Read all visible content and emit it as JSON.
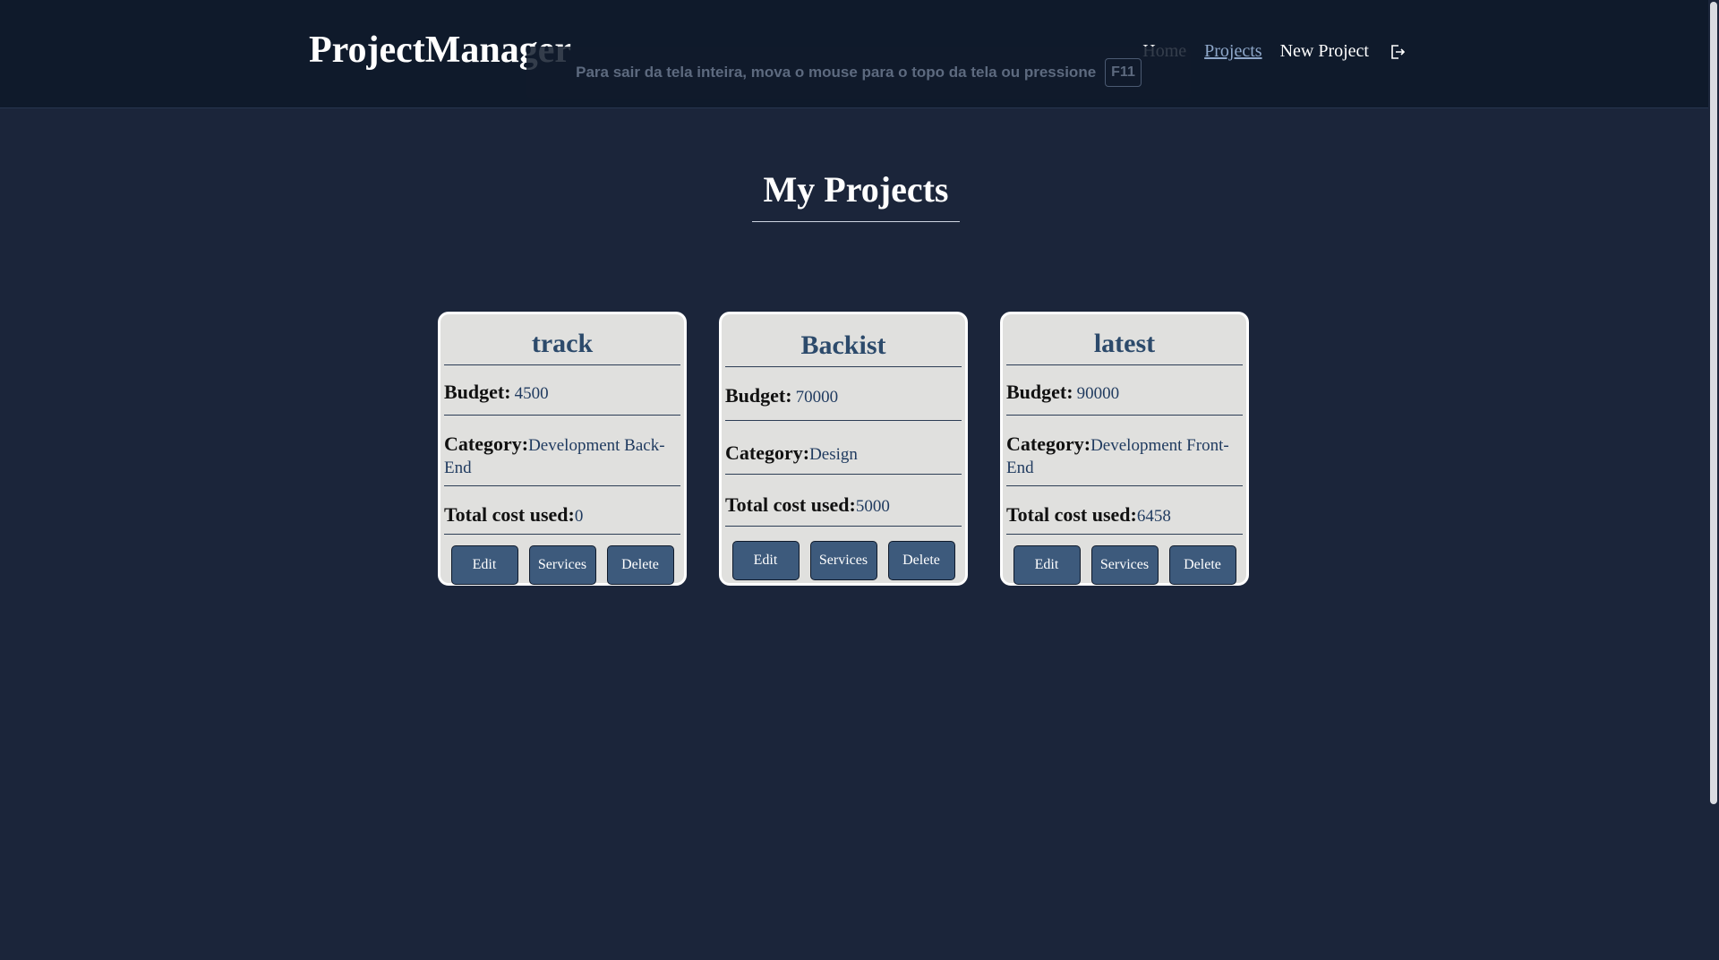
{
  "header": {
    "logo": "ProjectManager",
    "nav": {
      "home": "Home",
      "projects": "Projects",
      "new_project": "New Project"
    },
    "logout_icon": "logout-icon"
  },
  "fullscreen_notice": {
    "text": "Para sair da tela inteira, mova o mouse para o topo da tela ou pressione",
    "key": "F11"
  },
  "page": {
    "title": "My Projects"
  },
  "labels": {
    "budget": "Budget:",
    "category": "Category:",
    "total_cost": "Total cost used:",
    "edit": "Edit",
    "services": "Services",
    "delete": "Delete"
  },
  "projects": [
    {
      "name": "track",
      "budget": "4500",
      "category": "Development Back-End",
      "total_cost": "0"
    },
    {
      "name": "Backist",
      "budget": "70000",
      "category": "Design",
      "total_cost": "5000"
    },
    {
      "name": "latest",
      "budget": "90000",
      "category": "Development Front-End",
      "total_cost": "6458"
    }
  ],
  "colors": {
    "background": "#1b253a",
    "header": "#0f1a2b",
    "card": "#e0e0de",
    "button": "#3d5a7c",
    "accent_link": "#8ea7c9",
    "card_title": "#2c4a6b"
  }
}
